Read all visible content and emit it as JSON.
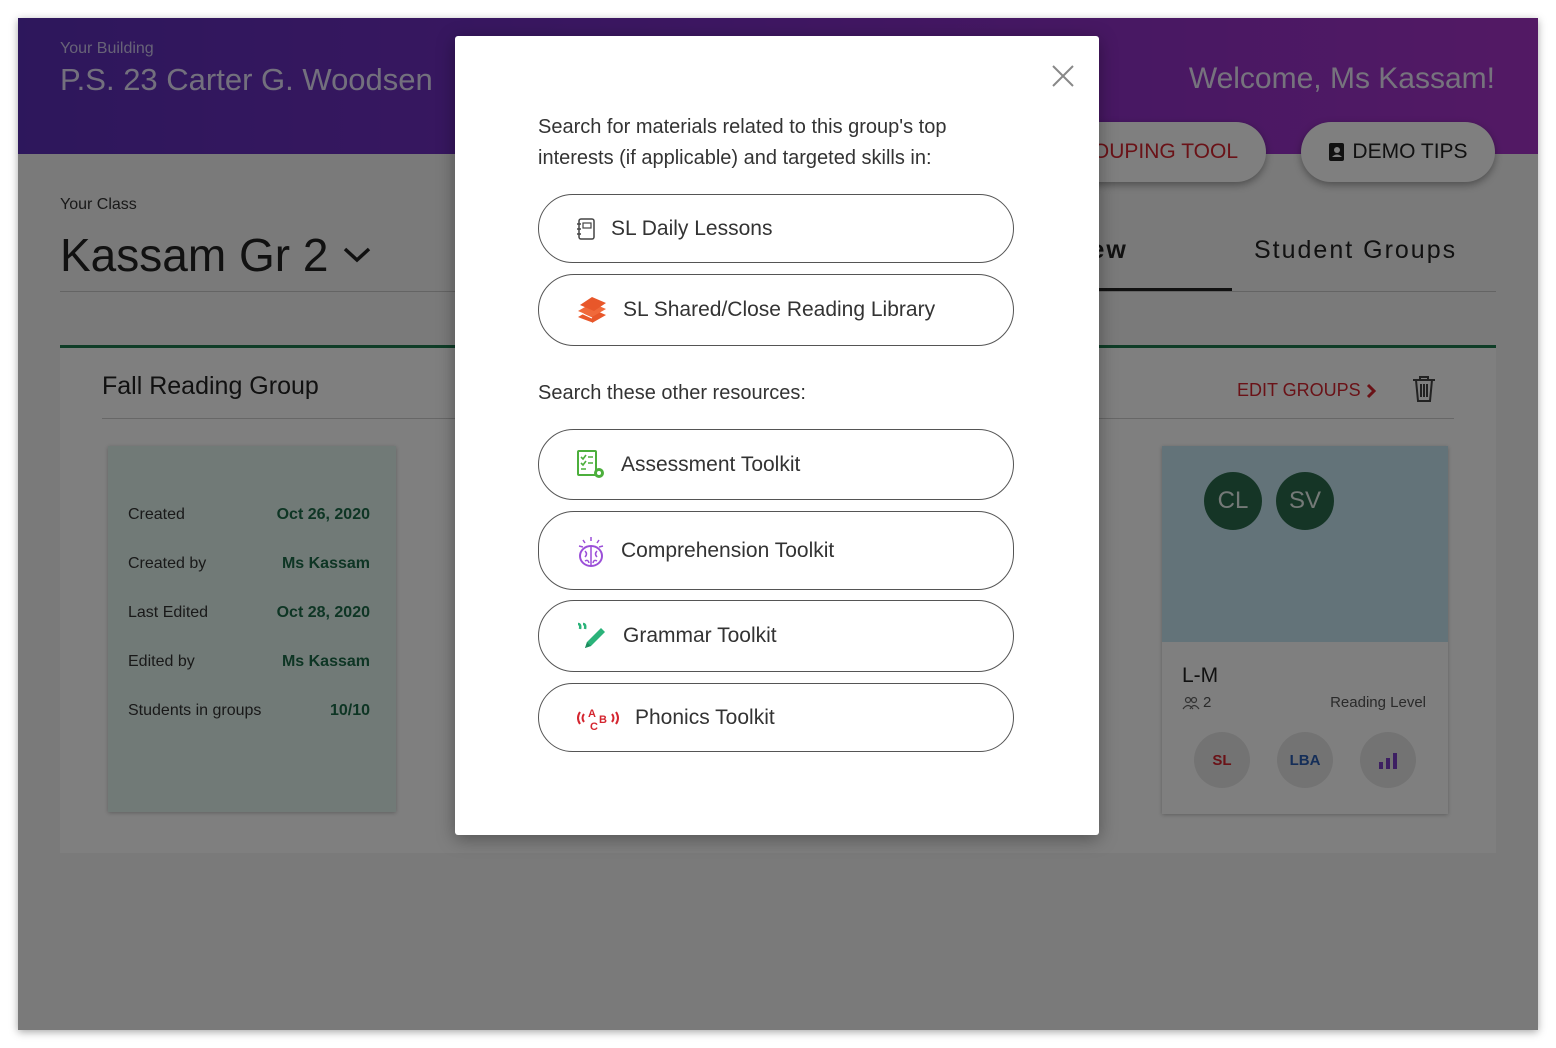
{
  "header": {
    "building_label": "Your Building",
    "building_name": "P.S. 23 Carter G. Woodsen",
    "welcome": "Welcome, Ms Kassam!",
    "grouping_tool_label": "OUPING TOOL",
    "demo_tips_label": "DEMO TIPS"
  },
  "class": {
    "label": "Your Class",
    "name": "Kassam Gr 2",
    "tabs": [
      {
        "label": "erview",
        "active": true
      },
      {
        "label": "Student Groups",
        "active": false
      }
    ]
  },
  "group": {
    "title": "Fall Reading Group",
    "edit_label": "EDIT GROUPS",
    "info": [
      {
        "label": "Created",
        "value": "Oct 26, 2020"
      },
      {
        "label": "Created by",
        "value": "Ms Kassam"
      },
      {
        "label": "Last Edited",
        "value": "Oct 28, 2020"
      },
      {
        "label": "Edited by",
        "value": "Ms Kassam"
      },
      {
        "label": "Students in groups",
        "value": "10/10"
      }
    ],
    "card": {
      "avatars": [
        "CL",
        "SV"
      ],
      "level": "L-M",
      "count": "2",
      "level_label": "Reading Level",
      "buttons": [
        "SL",
        "LBA"
      ]
    }
  },
  "modal": {
    "intro": "Search for materials related to this group's top interests (if applicable) and targeted skills in:",
    "primary": [
      {
        "label": "SL Daily Lessons",
        "icon": "notebook-icon"
      },
      {
        "label": "SL Shared/Close Reading Library",
        "icon": "books-stack-icon"
      }
    ],
    "other_heading": "Search these other resources:",
    "other": [
      {
        "label": "Assessment Toolkit",
        "icon": "checklist-gear-icon"
      },
      {
        "label": "Comprehension Toolkit",
        "icon": "brain-icon"
      },
      {
        "label": "Grammar Toolkit",
        "icon": "quote-pencil-icon"
      },
      {
        "label": "Phonics Toolkit",
        "icon": "abc-sound-icon"
      }
    ]
  },
  "colors": {
    "header_start": "#5b2fb8",
    "header_end": "#a633c9",
    "accent_red": "#d4252f",
    "group_green": "#1e7a4f"
  }
}
